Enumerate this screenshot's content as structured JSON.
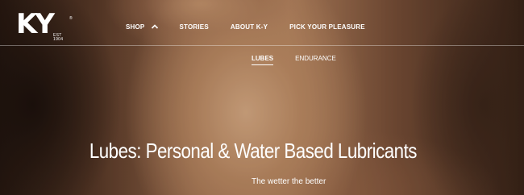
{
  "brand": {
    "logo_text": "KY",
    "est_line1": "EST",
    "est_line2": "1904",
    "registered": "®"
  },
  "nav": {
    "items": [
      {
        "label": "SHOP"
      },
      {
        "label": "STORIES"
      },
      {
        "label": "ABOUT K-Y"
      },
      {
        "label": "PICK YOUR PLEASURE"
      }
    ],
    "shop_icon": "chevron-up-icon"
  },
  "subnav": {
    "items": [
      {
        "label": "LUBES",
        "active": true
      },
      {
        "label": "ENDURANCE",
        "active": false
      }
    ]
  },
  "hero": {
    "title": "Lubes: Personal & Water Based Lubricants",
    "subtitle": "The wetter the better"
  },
  "colors": {
    "text": "#ffffff",
    "skin_highlight": "#deb088",
    "shadow": "#2a1a12"
  }
}
